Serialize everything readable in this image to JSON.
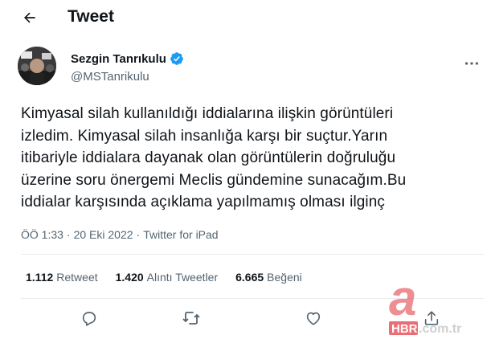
{
  "header": {
    "title": "Tweet",
    "back_icon": "arrow-left-icon"
  },
  "author": {
    "name": "Sezgin Tanrıkulu",
    "handle": "@MSTanrikulu",
    "verified": true,
    "verified_color": "#1d9bf0"
  },
  "tweet": {
    "lines": [
      "Kimyasal silah kullanıldığı iddialarına ilişkin  görüntüleri",
      "izledim. Kimyasal silah insanlığa karşı bir suçtur.Yarın",
      "itibariyle iddialara dayanak olan görüntülerin doğruluğu",
      "üzerine soru önergemi Meclis gündemine sunacağım.Bu",
      "iddialar karşısında açıklama yapılmamış olması ilginç"
    ],
    "time": "ÖÖ 1:33",
    "separator": "·",
    "date": "20 Eki 2022",
    "source": "Twitter for iPad"
  },
  "stats": {
    "retweets_count": "1.112",
    "retweets_label": "Retweet",
    "quotes_count": "1.420",
    "quotes_label": "Alıntı Tweetler",
    "likes_count": "6.665",
    "likes_label": "Beğeni"
  },
  "actions": [
    "reply-icon",
    "retweet-icon",
    "like-icon",
    "share-icon"
  ],
  "watermark": {
    "logo_text": "HBR",
    "suffix": ".com.tr",
    "letter": "a"
  }
}
